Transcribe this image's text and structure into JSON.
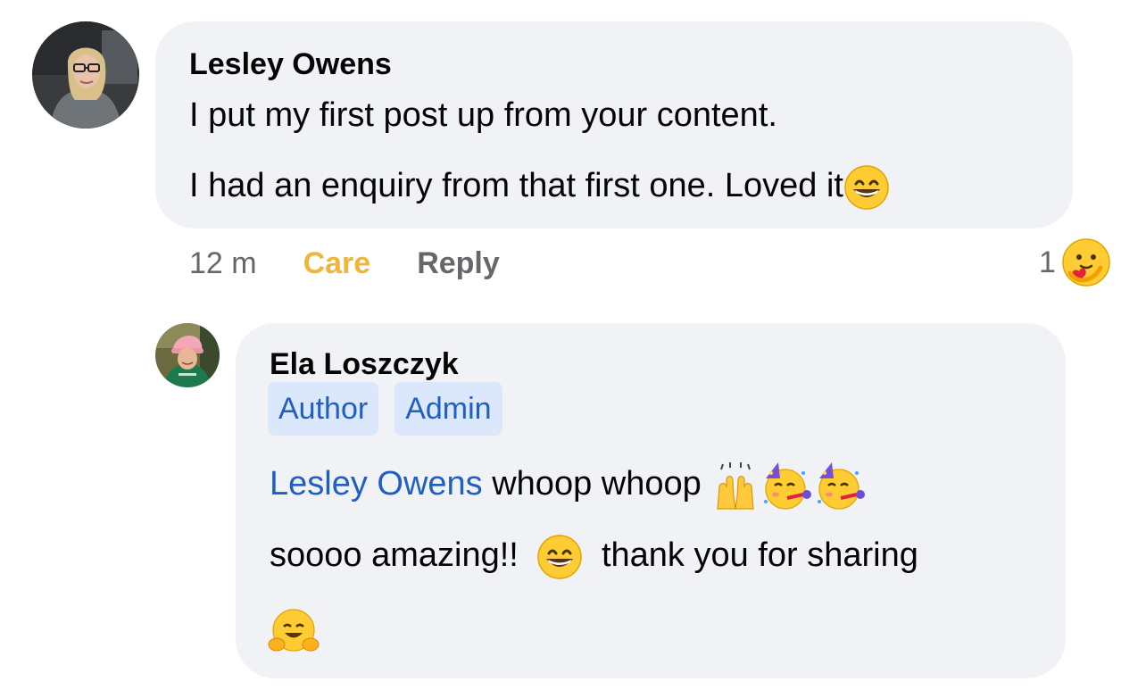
{
  "comment": {
    "author": "Lesley Owens",
    "lines": [
      "I put my first post up from your content.",
      "I had an enquiry from that first one. Loved it"
    ],
    "line_emoji": "grinning-face-emoji",
    "time": "12 m",
    "reaction_label": "Care",
    "reply_label": "Reply",
    "reaction_count": "1",
    "reaction_icon": "care-reaction-icon"
  },
  "reply": {
    "author": "Ela Loszczyk",
    "badges": [
      "Author",
      "Admin"
    ],
    "mention": "Lesley Owens",
    "line1_text": " whoop whoop",
    "line1_emojis": [
      "raising-hands-emoji",
      "partying-face-emoji",
      "partying-face-emoji"
    ],
    "line2_text_a": "soooo amazing!!",
    "line2_emoji": "grinning-face-emoji",
    "line2_text_b": "thank you for sharing",
    "line3_emoji": "hugging-face-emoji"
  },
  "colors": {
    "bubble": "#f0f2f5",
    "link": "#1f5fbf",
    "badge_bg": "#dbe7fb",
    "care": "#f2b53b",
    "meta": "#65676b"
  }
}
